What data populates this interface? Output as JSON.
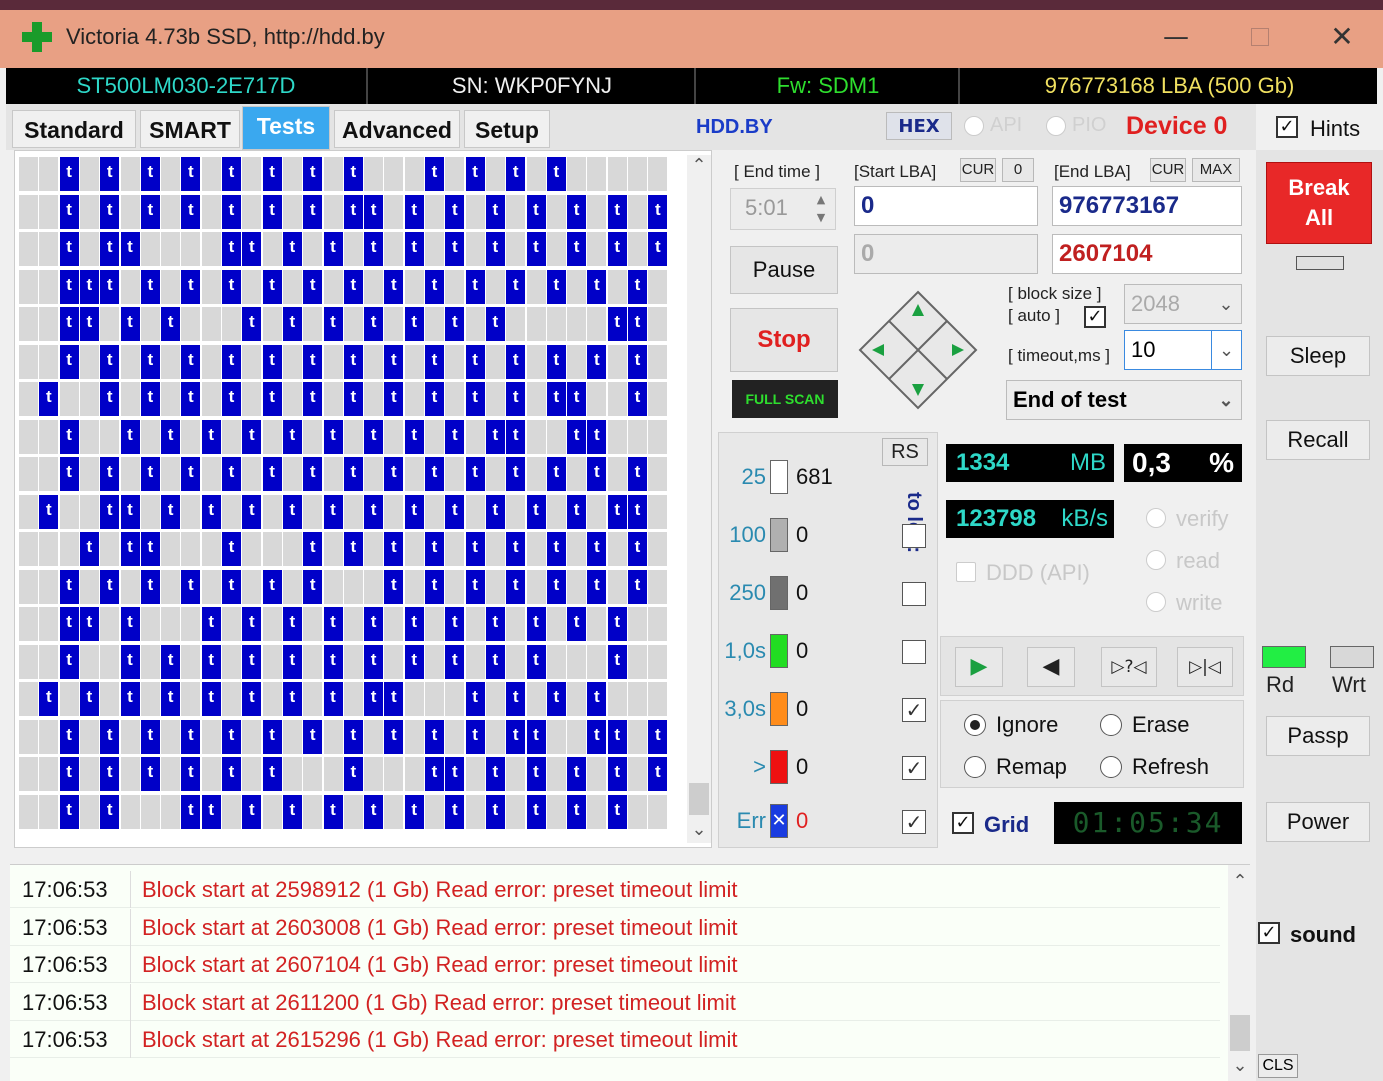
{
  "window": {
    "title": "Victoria 4.73b SSD, http://hdd.by"
  },
  "drive": {
    "model": "ST500LM030-2E717D",
    "serial": "SN: WKP0FYNJ",
    "firmware": "Fw: SDM1",
    "capacity": "976773168 LBA (500 Gb)"
  },
  "tabs": [
    "Standard",
    "SMART",
    "Tests",
    "Advanced",
    "Setup"
  ],
  "active_tab": "Tests",
  "toolbar": {
    "site": "HDD.BY",
    "hex": "HEX",
    "api": "API",
    "pio": "PIO",
    "device": "Device 0",
    "hints": "Hints",
    "hints_checked": true
  },
  "map": {
    "cell_label": "t",
    "rows": [
      "..t.t.t.t.t.t.t.t...t.t.t.t.....t",
      "..t.t.t.t.t.t.t.tt.t.t.t.t.t.t.t",
      "..t.tt....tt.t.t.t.t.t.t.t.t.t.t",
      "..ttt.t.t.t.t.t.t.t.t.t.t.t.t.t",
      "..tt.t.t...t.t.t.t.t.t.t.....tt",
      "..t.t.t.t.t.t.t.t.t.t.t.t.t.t.t",
      ".t..t.t.t.t.t.t.t.t.t.t.t.tt..t",
      "..t..t.t.t.t.t.t.t.t.t.tt..tt",
      "..t.t.t.t.t.t.t.t.t.t.t.t.t.t.t",
      ".t..tt.t.t.t.t.t.t.t.t.t.t.t.tt",
      "...t.tt...t...t.t.t.t.t.t.t.t.t",
      "..t.t.t.t.t.t.t...t.t.t.t.t.t.t",
      "..tt.t...t.t.t.t.t.t.t.t.t.t.t",
      "..t..t.t.t.t.t.t.t.t.t.t.t...t",
      ".t.t.t.t.t.t.t.t.tt...t.t.t.t",
      "..t.t.t.t.t.t.t.t.t.t.t.tt..tt.t",
      "..t.t.t.t.t.t...t...tt.t.t.t.t.t",
      "..t.t...tt.t.t.t.t.t.t.t.t.t.t"
    ]
  },
  "timing": {
    "end_time_label": "[ End time ]",
    "end_time_value": "5:01",
    "pause": "Pause",
    "stop": "Stop",
    "full_scan": "FULL SCAN"
  },
  "lba": {
    "start_label": "[Start LBA]",
    "cur": "CUR",
    "zero": "0",
    "end_label": "[End LBA]",
    "max": "MAX",
    "start_value": "0",
    "end_value": "976773167",
    "current_start": "0",
    "current_value": "2607104"
  },
  "block": {
    "block_size_label": "[ block size ]",
    "auto_label": "[ auto ]",
    "auto_checked": true,
    "block_size_value": "2048",
    "timeout_label": "[ timeout,ms ]",
    "timeout_value": "10",
    "end_action": "End of test"
  },
  "stats": {
    "rs": "RS",
    "to_log": "to log:",
    "latency": [
      {
        "label": "25",
        "count": "681",
        "color": "#ffffff",
        "logged": null
      },
      {
        "label": "100",
        "count": "0",
        "color": "#b0b0b0",
        "logged": false
      },
      {
        "label": "250",
        "count": "0",
        "color": "#707070",
        "logged": false
      },
      {
        "label": "1,0s",
        "count": "0",
        "color": "#22dd22",
        "logged": false
      },
      {
        "label": "3,0s",
        "count": "0",
        "color": "#ff8c1a",
        "logged": true
      },
      {
        "label": ">",
        "count": "0",
        "color": "#ee1111",
        "logged": true
      },
      {
        "label": "Err",
        "count": "0",
        "color": "#1a3ce0",
        "logged": true
      }
    ]
  },
  "progress": {
    "mb_value": "1334",
    "mb_unit": "MB",
    "percent_value": "0,3",
    "percent_unit": "%",
    "speed_value": "123798",
    "speed_unit": "kB/s",
    "ddd": "DDD (API)",
    "verify": "verify",
    "read": "read",
    "write": "write"
  },
  "player": {
    "play": "▶",
    "back": "◀",
    "step_back": "▷?◁",
    "to_end": "▷|◁"
  },
  "actions": {
    "ignore": "Ignore",
    "erase": "Erase",
    "remap": "Remap",
    "refresh": "Refresh",
    "selected": "Ignore",
    "grid": "Grid",
    "grid_checked": true,
    "timer": "01:05:34"
  },
  "right": {
    "break_all_1": "Break",
    "break_all_2": "All",
    "sleep": "Sleep",
    "recall": "Recall",
    "rd": "Rd",
    "wrt": "Wrt",
    "passp": "Passp",
    "power": "Power",
    "sound": "sound",
    "sound_checked": true,
    "cls": "CLS"
  },
  "log": [
    {
      "time": "17:06:53",
      "msg": "Block start at 2598912 (1 Gb) Read error: preset timeout limit"
    },
    {
      "time": "17:06:53",
      "msg": "Block start at 2603008 (1 Gb) Read error: preset timeout limit"
    },
    {
      "time": "17:06:53",
      "msg": "Block start at 2607104 (1 Gb) Read error: preset timeout limit"
    },
    {
      "time": "17:06:53",
      "msg": "Block start at 2611200 (1 Gb) Read error: preset timeout limit"
    },
    {
      "time": "17:06:53",
      "msg": "Block start at 2615296 (1 Gb) Read error: preset timeout limit"
    }
  ],
  "colors": {
    "title_bar": "#e8a084",
    "active_tab": "#3aa8ef",
    "map_block": "#0000c8",
    "error_text": "#d22222",
    "lcd_text": "#2ed8c8",
    "break_all": "#e82828",
    "led_read": "#22ee44"
  }
}
